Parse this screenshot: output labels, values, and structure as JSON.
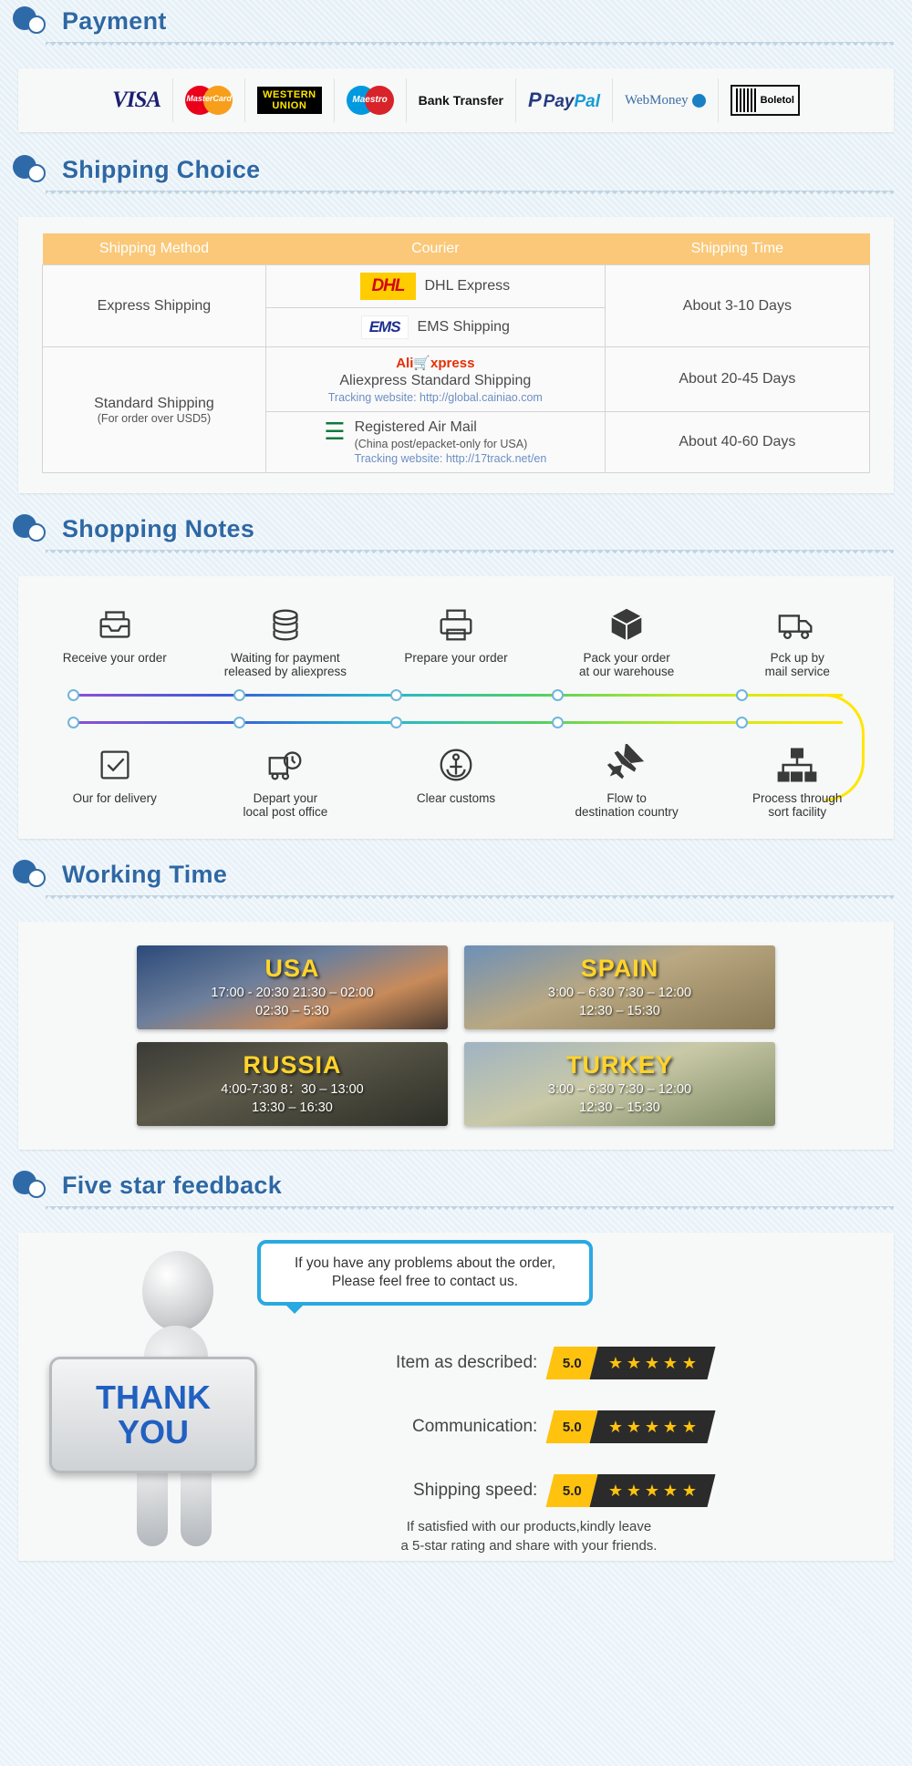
{
  "sections": {
    "payment": {
      "title": "Payment"
    },
    "shipping": {
      "title": "Shipping Choice"
    },
    "notes": {
      "title": "Shopping Notes"
    },
    "working": {
      "title": "Working Time"
    },
    "feedback": {
      "title": "Five star feedback"
    }
  },
  "payment": {
    "methods": [
      {
        "name": "visa-logo",
        "label": "VISA"
      },
      {
        "name": "mastercard-logo",
        "label": "MasterCard"
      },
      {
        "name": "western-union-logo",
        "label_line1": "WESTERN",
        "label_line2": "UNION"
      },
      {
        "name": "maestro-logo",
        "label": "Maestro"
      },
      {
        "name": "bank-transfer-logo",
        "label": "Bank Transfer"
      },
      {
        "name": "paypal-logo",
        "label_a": "Pay",
        "label_b": "Pal"
      },
      {
        "name": "webmoney-logo",
        "label": "WebMoney"
      },
      {
        "name": "boleto-logo",
        "label": "Boletol"
      }
    ]
  },
  "shipping_table": {
    "headers": [
      "Shipping Method",
      "Courier",
      "Shipping Time"
    ],
    "rows": [
      {
        "method": "Express Shipping",
        "method_note": "",
        "time": "About 3-10 Days",
        "couriers": [
          {
            "logo": "DHL",
            "name": "DHL Express",
            "note": "",
            "track": ""
          },
          {
            "logo": "EMS",
            "name": "EMS Shipping",
            "note": "",
            "track": ""
          }
        ]
      },
      {
        "method": "Standard Shipping",
        "method_note": "(For order over USD5)",
        "time": "About 20-45 Days",
        "couriers": [
          {
            "logo": "AliExpress",
            "name": "Aliexpress Standard Shipping",
            "note": "",
            "track": "Tracking website: http://global.cainiao.com"
          }
        ]
      },
      {
        "method": "",
        "method_note": "",
        "time": "About 40-60 Days",
        "couriers": [
          {
            "logo": "ChinaPost",
            "name": "Registered Air Mail",
            "note": "(China post/epacket-only for USA)",
            "track": "Tracking website: http://17track.net/en"
          }
        ]
      }
    ]
  },
  "shopping_notes": {
    "top_steps": [
      {
        "icon": "inbox-tray-icon",
        "label": "Receive your order"
      },
      {
        "icon": "coins-stack-icon",
        "label": "Waiting for payment\nreleased by aliexpress"
      },
      {
        "icon": "printer-icon",
        "label": "Prepare your order"
      },
      {
        "icon": "package-box-icon",
        "label": "Pack your order\nat our warehouse"
      },
      {
        "icon": "delivery-truck-icon",
        "label": "Pck up by\nmail service"
      }
    ],
    "bottom_steps": [
      {
        "icon": "checked-document-icon",
        "label": "Our for delivery"
      },
      {
        "icon": "truck-clock-icon",
        "label": "Depart your\nlocal post office"
      },
      {
        "icon": "anchor-icon",
        "label": "Clear customs"
      },
      {
        "icon": "airplane-icon",
        "label": "Flow to\ndestination country"
      },
      {
        "icon": "sort-facility-icon",
        "label": "Process through\nsort facility"
      }
    ]
  },
  "working_time": {
    "cards": [
      {
        "country": "USA",
        "hours_line1": "17:00  -  20:30   21:30  –  02:00",
        "hours_line2": "02:30  –  5:30",
        "theme": "bg-usa"
      },
      {
        "country": "SPAIN",
        "hours_line1": "3:00  –   6:30    7:30  –  12:00",
        "hours_line2": "12:30  –  15:30",
        "theme": "bg-spain"
      },
      {
        "country": "RUSSIA",
        "hours_line1": "4:00-7:30    8：30  –  13:00",
        "hours_line2": "13:30  –  16:30",
        "theme": "bg-russia"
      },
      {
        "country": "TURKEY",
        "hours_line1": "3:00  –   6:30   7:30  –  12:00",
        "hours_line2": "12:30  –  15:30",
        "theme": "bg-turkey"
      }
    ]
  },
  "feedback": {
    "sign_line1": "THANK",
    "sign_line2": "YOU",
    "bubble_line1": "If you have any problems about the order,",
    "bubble_line2": "Please feel free to contact us.",
    "ratings": [
      {
        "label": "Item as described:",
        "score": "5.0",
        "stars": 5
      },
      {
        "label": "Communication:",
        "score": "5.0",
        "stars": 5
      },
      {
        "label": "Shipping speed:",
        "score": "5.0",
        "stars": 5
      }
    ],
    "footer_line1": "If satisfied with our products,kindly leave",
    "footer_line2": "a 5-star rating and share with your friends."
  },
  "colors": {
    "section_title": "#2e68a4",
    "table_header": "#fac878",
    "track_link": "#6b8fc4",
    "star": "#ffc20e",
    "bubble_border": "#29a9e1"
  }
}
